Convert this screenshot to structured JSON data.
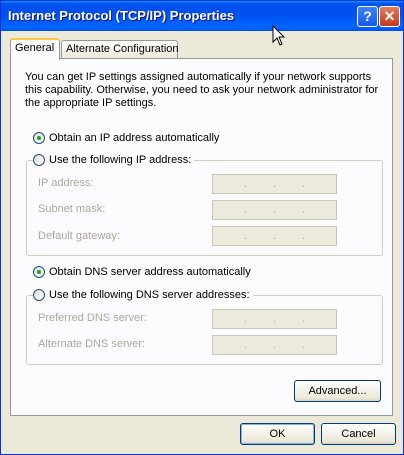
{
  "window": {
    "title": "Internet Protocol (TCP/IP) Properties",
    "help_label": "?",
    "close_label": "✕"
  },
  "tabs": [
    {
      "label": "General"
    },
    {
      "label": "Alternate Configuration"
    }
  ],
  "general": {
    "description": "You can get IP settings assigned automatically if your network supports this capability. Otherwise, you need to ask your network administrator for the appropriate IP settings.",
    "ip": {
      "auto_label": "Obtain an IP address automatically",
      "manual_label": "Use the following IP address:",
      "selected": "auto",
      "fields": [
        {
          "label": "IP address:"
        },
        {
          "label": "Subnet mask:"
        },
        {
          "label": "Default gateway:"
        }
      ]
    },
    "dns": {
      "auto_label": "Obtain DNS server address automatically",
      "manual_label": "Use the following DNS server addresses:",
      "selected": "auto",
      "fields": [
        {
          "label": "Preferred DNS server:"
        },
        {
          "label": "Alternate DNS server:"
        }
      ]
    },
    "advanced_label": "Advanced..."
  },
  "footer": {
    "ok_label": "OK",
    "cancel_label": "Cancel"
  }
}
